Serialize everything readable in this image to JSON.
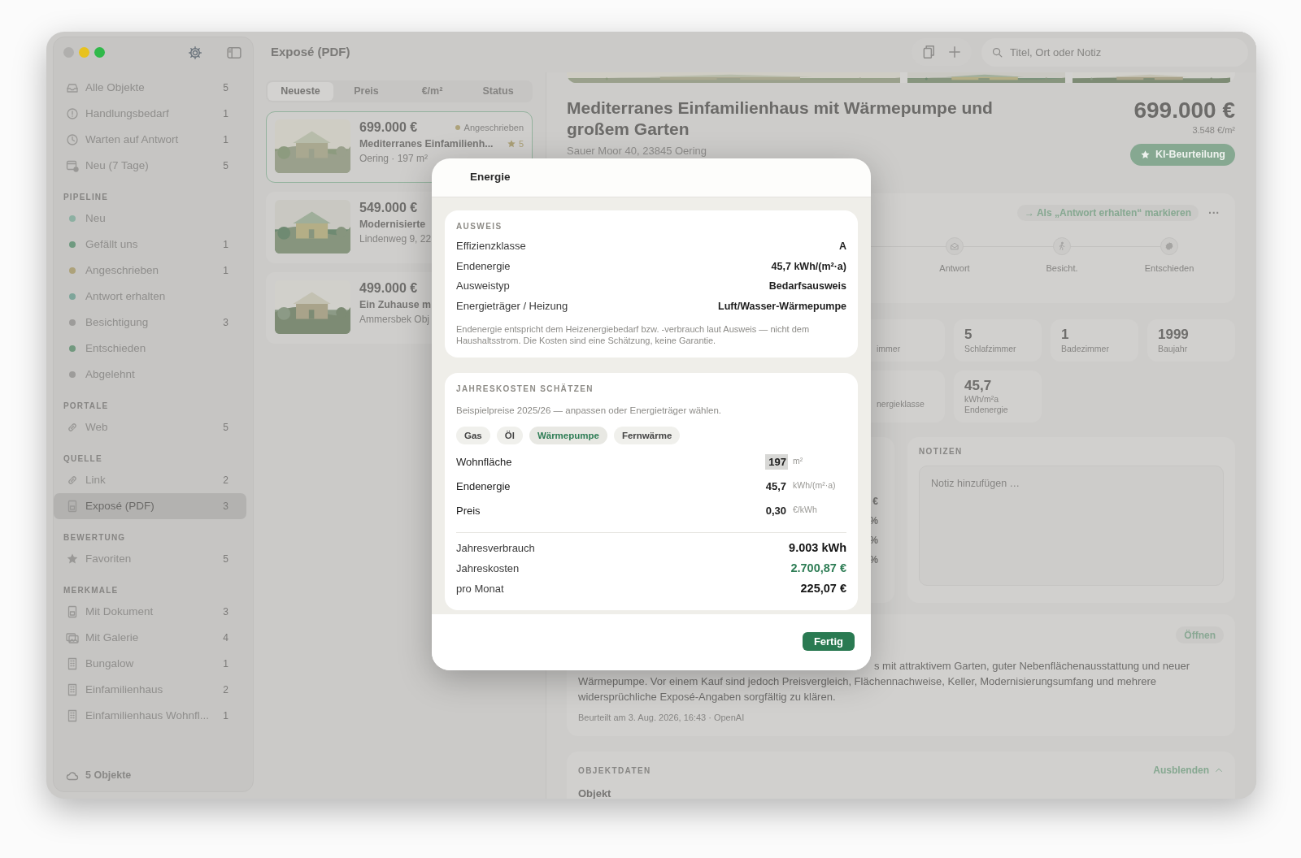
{
  "window": {
    "title": "Exposé (PDF)"
  },
  "sidebar": {
    "sections": [
      {
        "items": [
          {
            "label": "Alle Objekte",
            "count": "5",
            "kind": "icon",
            "selected": false
          },
          {
            "label": "Handlungsbedarf",
            "count": "1",
            "kind": "icon",
            "selected": false
          },
          {
            "label": "Warten auf Antwort",
            "count": "1",
            "kind": "icon",
            "selected": false
          },
          {
            "label": "Neu (7 Tage)",
            "count": "5",
            "kind": "icon",
            "selected": false
          }
        ]
      },
      {
        "heading": "PIPELINE",
        "items": [
          {
            "label": "Neu",
            "kind": "dot",
            "color": "#8db0a2",
            "selected": false
          },
          {
            "label": "Gefällt uns",
            "count": "1",
            "kind": "dot",
            "color": "#6f9a80",
            "selected": false
          },
          {
            "label": "Angeschrieben",
            "count": "1",
            "kind": "dot",
            "color": "#ada27a",
            "selected": false
          },
          {
            "label": "Antwort erhalten",
            "kind": "dot",
            "color": "#7ea59a",
            "selected": false
          },
          {
            "label": "Besichtigung",
            "count": "3",
            "kind": "dot",
            "color": "#9d9c9a",
            "selected": false
          },
          {
            "label": "Entschieden",
            "kind": "dot",
            "color": "#72997f",
            "selected": false
          },
          {
            "label": "Abgelehnt",
            "kind": "dot",
            "color": "#9d9c9a",
            "selected": false
          }
        ]
      },
      {
        "heading": "PORTALE",
        "items": [
          {
            "label": "Web",
            "count": "5",
            "kind": "icon",
            "selected": false
          }
        ]
      },
      {
        "heading": "QUELLE",
        "items": [
          {
            "label": "Link",
            "count": "2",
            "kind": "icon",
            "selected": false
          },
          {
            "label": "Exposé (PDF)",
            "count": "3",
            "kind": "icon",
            "selected": true
          }
        ]
      },
      {
        "heading": "BEWERTUNG",
        "items": [
          {
            "label": "Favoriten",
            "count": "5",
            "kind": "icon",
            "selected": false
          }
        ]
      },
      {
        "heading": "MERKMALE",
        "items": [
          {
            "label": "Mit Dokument",
            "count": "3",
            "kind": "icon",
            "selected": false
          },
          {
            "label": "Mit Galerie",
            "count": "4",
            "kind": "icon",
            "selected": false
          },
          {
            "label": "Bungalow",
            "count": "1",
            "kind": "icon",
            "selected": false
          },
          {
            "label": "Einfamilienhaus",
            "count": "2",
            "kind": "icon",
            "selected": false
          },
          {
            "label": "Einfamilienhaus Wohnfl...",
            "count": "1",
            "kind": "icon",
            "selected": false
          }
        ]
      }
    ],
    "footer": "5 Objekte"
  },
  "toolbar": {
    "search": {
      "placeholder": "Titel, Ort oder Notiz"
    }
  },
  "list": {
    "sort_tabs": [
      {
        "label": "Neueste",
        "selected": true
      },
      {
        "label": "Preis",
        "selected": false
      },
      {
        "label": "€/m²",
        "selected": false
      },
      {
        "label": "Status",
        "selected": false
      }
    ],
    "cards": [
      {
        "price": "699.000 €",
        "title": "Mediterranes Einfamilienh...",
        "meta": "Oering · 197 m²",
        "status": {
          "label": "Angeschrieben",
          "color": "#ada27a"
        },
        "rating": "5",
        "selected": true
      },
      {
        "price": "549.000 €",
        "title": "Modernisierte",
        "meta": "Lindenweg 9, 22",
        "selected": false
      },
      {
        "price": "499.000 €",
        "title": "Ein Zuhause m",
        "meta": "Ammersbek Obj",
        "selected": false
      }
    ]
  },
  "detail": {
    "title": "Mediterranes Einfamilienhaus mit Wärmepumpe und großem Garten",
    "address": "Sauer Moor 40, 23845 Oering",
    "price": "699.000 €",
    "price_per_sqm": "3.548 €/m²",
    "ai_button": "KI-Beurteilung",
    "pipeline": {
      "mark_button": "→ Als „Antwort erhalten“ markieren",
      "more": "···",
      "steps": [
        {
          "label": "Antwort"
        },
        {
          "label": "Besicht."
        },
        {
          "label": "Entschieden"
        }
      ]
    },
    "stat_rows": [
      [
        {
          "kind": "clipped",
          "label": "immer"
        },
        {
          "kind": "stat",
          "value": "5",
          "label": "Schlafzimmer"
        },
        {
          "kind": "stat",
          "value": "1",
          "label": "Badezimmer"
        },
        {
          "kind": "stat",
          "value": "1999",
          "label": "Baujahr"
        }
      ],
      [
        {
          "kind": "clipped",
          "label": "nergieklasse"
        },
        {
          "kind": "stat",
          "value": "45,7",
          "unit": "kWh/m²a",
          "label": "Endenergie"
        }
      ]
    ],
    "price_card": {
      "fragments": [
        "€",
        "%",
        "%",
        "%"
      ]
    },
    "notes": {
      "heading": "NOTIZEN",
      "placeholder": "Notiz hinzufügen …"
    },
    "ai": {
      "open_button": "Öffnen",
      "text": "s mit attraktivem Garten, guter Nebenflächenausstattung und neuer Wärmepumpe. Vor einem Kauf sind jedoch Preisvergleich, Flächennachweise, Keller, Modernisierungsumfang und mehrere widersprüchliche Exposé-Angaben sorgfältig zu klären.",
      "footer": "Beurteilt am 3. Aug. 2026, 16:43 · OpenAI"
    },
    "objektdaten": {
      "heading": "OBJEKTDATEN",
      "toggle": "Ausblenden",
      "expanded": true,
      "subheading": "Objekt"
    }
  },
  "modal": {
    "title": "Energie",
    "certificate": {
      "heading": "AUSWEIS",
      "rows": [
        {
          "label": "Effizienzklasse",
          "value": "A"
        },
        {
          "label": "Endenergie",
          "value": "45,7 kWh/(m²·a)"
        },
        {
          "label": "Ausweistyp",
          "value": "Bedarfsausweis"
        },
        {
          "label": "Energieträger / Heizung",
          "value": "Luft/Wasser-Wärmepumpe"
        }
      ],
      "note": "Endenergie entspricht dem Heizenergiebedarf bzw. -verbrauch laut Ausweis — nicht dem Haushaltsstrom. Die Kosten sind eine Schätzung, keine Garantie."
    },
    "estimate": {
      "heading": "JAHRESKOSTEN SCHÄTZEN",
      "hint": "Beispielpreise 2025/26 — anpassen oder Energieträger wählen.",
      "carriers": [
        {
          "label": "Gas",
          "selected": false
        },
        {
          "label": "Öl",
          "selected": false
        },
        {
          "label": "Wärmepumpe",
          "selected": true
        },
        {
          "label": "Fernwärme",
          "selected": false
        }
      ],
      "inputs": [
        {
          "label": "Wohnfläche",
          "value": "197",
          "unit": "m²",
          "focused": true
        },
        {
          "label": "Endenergie",
          "value": "45,7",
          "unit": "kWh/(m²·a)",
          "focused": false
        },
        {
          "label": "Preis",
          "value": "0,30",
          "unit": "€/kWh",
          "focused": false
        }
      ],
      "results": [
        {
          "label": "Jahresverbrauch",
          "value": "9.003 kWh",
          "highlight": false
        },
        {
          "label": "Jahreskosten",
          "value": "2.700,87 €",
          "highlight": true
        },
        {
          "label": "pro Monat",
          "value": "225,07 €",
          "highlight": false
        }
      ]
    },
    "done_button": "Fertig"
  }
}
